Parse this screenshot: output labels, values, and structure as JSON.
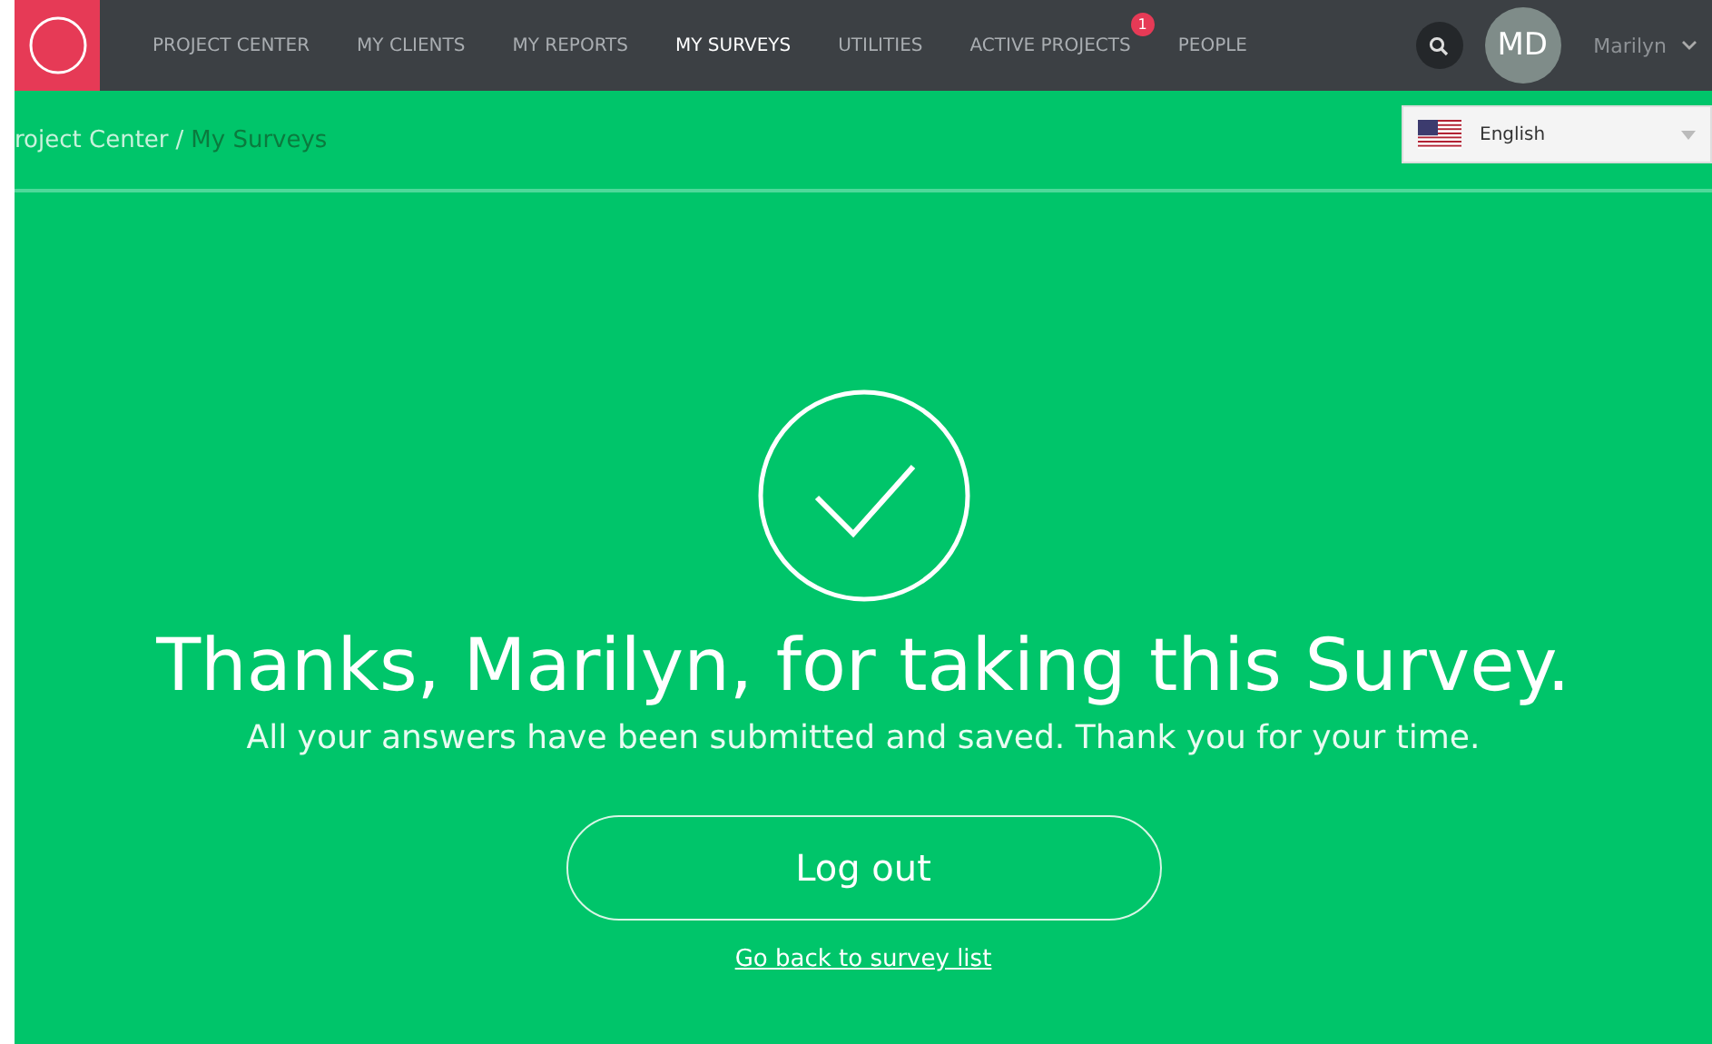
{
  "nav": {
    "items": [
      {
        "label": "PROJECT CENTER",
        "selected": false
      },
      {
        "label": "MY CLIENTS",
        "selected": false
      },
      {
        "label": "MY REPORTS",
        "selected": false
      },
      {
        "label": "MY SURVEYS",
        "selected": true
      },
      {
        "label": "UTILITIES",
        "selected": false
      },
      {
        "label": "ACTIVE PROJECTS",
        "selected": false,
        "badge": "1"
      },
      {
        "label": "PEOPLE",
        "selected": false
      }
    ],
    "avatar": "MD",
    "user": "Marilyn"
  },
  "breadcrumb": [
    {
      "label": "roject Center",
      "selected": false
    },
    {
      "label": "My Surveys",
      "selected": true
    }
  ],
  "breadcrumb_separator": "/",
  "language": {
    "value": "English"
  },
  "thanks": {
    "title": "Thanks, Marilyn, for taking this Survey.",
    "message": "All your answers have been submitted and saved. Thank you for your time.",
    "button": "Log out",
    "link": "Go back to survey list"
  }
}
